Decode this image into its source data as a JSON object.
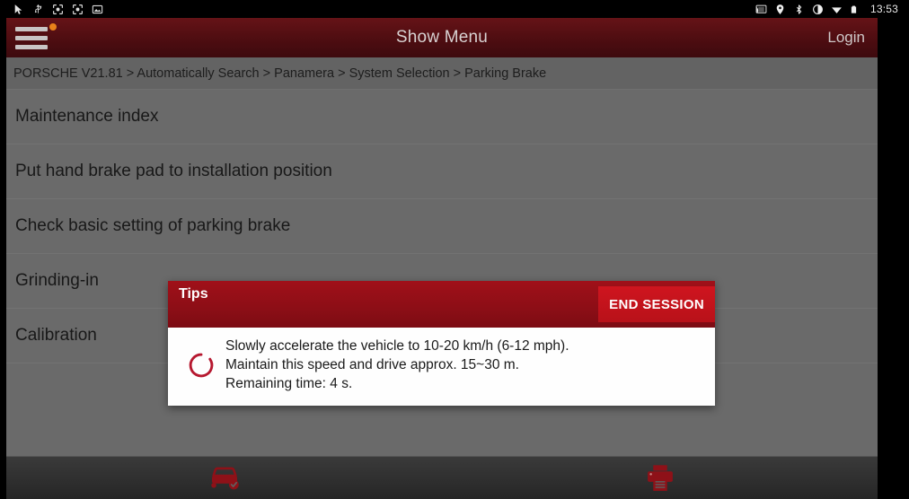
{
  "statusbar": {
    "left_icons": [
      "cursor-icon",
      "usb-icon",
      "screenshot-icon",
      "screenshot-icon-2",
      "image-icon"
    ],
    "right_icons": [
      "cast-icon",
      "location-icon",
      "bluetooth-icon",
      "vibrate-icon",
      "wifi-icon",
      "battery-icon"
    ],
    "time": "13:53"
  },
  "appbar": {
    "menu_icon": "hamburger-menu-icon",
    "has_notification_dot": true,
    "title": "Show Menu",
    "login_label": "Login",
    "accent": "#4e0d11"
  },
  "breadcrumb": {
    "text": "PORSCHE V21.81 > Automatically Search > Panamera > System Selection > Parking Brake"
  },
  "menu": {
    "items": [
      {
        "label": "Maintenance index"
      },
      {
        "label": "Put hand brake pad to installation position"
      },
      {
        "label": "Check basic setting of parking brake"
      },
      {
        "label": "Grinding-in"
      },
      {
        "label": "Calibration"
      }
    ]
  },
  "dialog": {
    "title": "Tips",
    "end_session_label": "END SESSION",
    "spinner_icon": "loading-spinner-icon",
    "lines": [
      "Slowly accelerate the vehicle to 10-20 km/h (6-12 mph).",
      "Maintain this speed and drive approx. 15~30 m.",
      "Remaining time: 4 s."
    ],
    "header_color": "#8c0e16",
    "button_color": "#cf151f"
  },
  "bottombar": {
    "buttons": [
      {
        "icon": "car-check-icon",
        "name": "vehicle-status-button"
      },
      {
        "icon": "printer-icon",
        "name": "print-button"
      }
    ],
    "icon_color": "#8e1118"
  }
}
